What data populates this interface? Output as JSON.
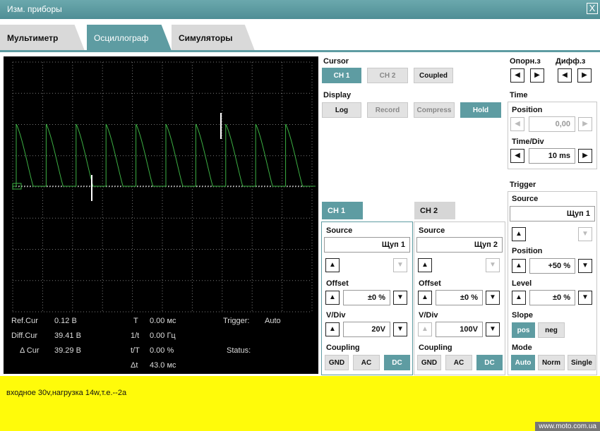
{
  "window": {
    "title": "Изм. приборы",
    "close": "X"
  },
  "tabs": [
    "Мультиметр",
    "Осциллограф",
    "Симуляторы"
  ],
  "scope": {
    "readouts": {
      "ref_label": "Ref.Cur",
      "ref_value": "0.12 В",
      "diff_label": "Diff.Cur",
      "diff_value": "39.41 В",
      "delta_label": "Δ Cur",
      "delta_value": "39.29 В",
      "t_label": "T",
      "t_value": "0.00 мс",
      "inv_t_label": "1/t",
      "inv_t_value": "0.00 Гц",
      "tT_label": "t/T",
      "tT_value": "0.00 %",
      "dt_label": "Δt",
      "dt_value": "43.0 мс",
      "trigger_label": "Trigger:",
      "trigger_value": "Auto",
      "status_label": "Status:"
    },
    "trace_color": "#3cb043"
  },
  "cursor": {
    "label": "Cursor",
    "ch1": "CH 1",
    "ch2": "CH 2",
    "coupled": "Coupled"
  },
  "display": {
    "label": "Display",
    "log": "Log",
    "record": "Record",
    "compress": "Compress",
    "hold": "Hold"
  },
  "nav": {
    "ref_label": "Опорн.з",
    "diff_label": "Дифф.з",
    "left": "◀",
    "right": "▶"
  },
  "time": {
    "label": "Time",
    "position_label": "Position",
    "position_value": "0,00",
    "div_label": "Time/Div",
    "div_value": "10 ms"
  },
  "ch1": {
    "tab": "CH 1",
    "source_label": "Source",
    "source_value": "Щуп 1",
    "offset_label": "Offset",
    "offset_value": "±0 %",
    "vdiv_label": "V/Div",
    "vdiv_value": "20V",
    "coupling_label": "Coupling",
    "gnd": "GND",
    "ac": "AC",
    "dc": "DC"
  },
  "ch2": {
    "tab": "CH 2",
    "source_label": "Source",
    "source_value": "Щуп 2",
    "offset_label": "Offset",
    "offset_value": "±0 %",
    "vdiv_label": "V/Div",
    "vdiv_value": "100V",
    "coupling_label": "Coupling",
    "gnd": "GND",
    "ac": "AC",
    "dc": "DC"
  },
  "trigger": {
    "label": "Trigger",
    "source_label": "Source",
    "source_value": "Щуп 1",
    "position_label": "Position",
    "position_value": "+50 %",
    "level_label": "Level",
    "level_value": "±0 %",
    "slope_label": "Slope",
    "pos": "pos",
    "neg": "neg",
    "mode_label": "Mode",
    "auto": "Auto",
    "norm": "Norm",
    "single": "Single"
  },
  "arrows": {
    "up": "▲",
    "down": "▼"
  },
  "note": {
    "text": "входное 30v,нагрузка 14w,т.е.--2а"
  },
  "watermark": "www.moto.com.ua",
  "colors": {
    "accent": "#5e9ca2",
    "note_bg": "#fffb0a"
  }
}
